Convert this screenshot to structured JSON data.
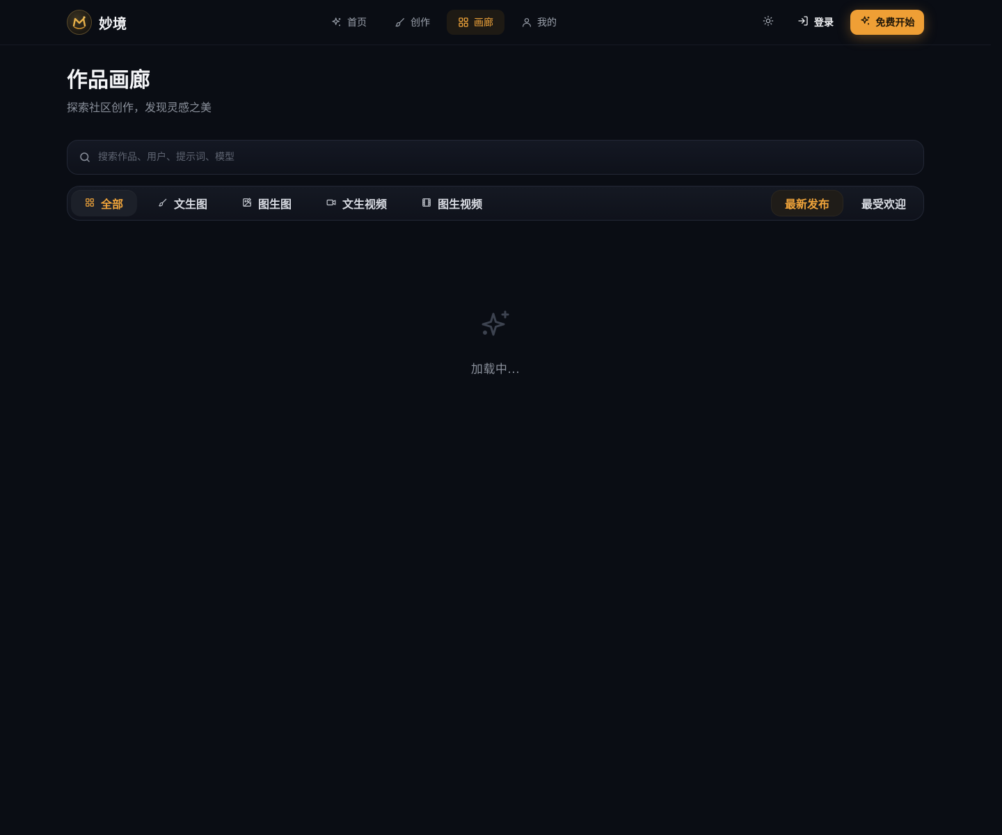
{
  "brand": {
    "name": "妙境",
    "logo_icon": "brand-logo-icon",
    "accent_color": "#ef9f35"
  },
  "nav": {
    "items": [
      {
        "label": "首页",
        "icon": "sparkles-icon",
        "active": false
      },
      {
        "label": "创作",
        "icon": "brush-icon",
        "active": false
      },
      {
        "label": "画廊",
        "icon": "grid-icon",
        "active": true
      },
      {
        "label": "我的",
        "icon": "user-icon",
        "active": false
      }
    ]
  },
  "header_actions": {
    "theme_icon": "sun-icon",
    "login_label": "登录",
    "login_icon": "login-icon",
    "start_label": "免费开始",
    "start_icon": "sparkles-icon"
  },
  "page": {
    "title": "作品画廊",
    "subtitle": "探索社区创作，发现灵感之美"
  },
  "search": {
    "placeholder": "搜索作品、用户、提示词、模型",
    "value": ""
  },
  "filters": {
    "categories": [
      {
        "label": "全部",
        "icon": "grid-icon",
        "active": true
      },
      {
        "label": "文生图",
        "icon": "brush-icon",
        "active": false
      },
      {
        "label": "图生图",
        "icon": "image-edit-icon",
        "active": false
      },
      {
        "label": "文生视频",
        "icon": "video-camera-icon",
        "active": false
      },
      {
        "label": "图生视频",
        "icon": "film-icon",
        "active": false
      }
    ],
    "sort": [
      {
        "label": "最新发布",
        "active": true
      },
      {
        "label": "最受欢迎",
        "active": false
      }
    ]
  },
  "loading": {
    "icon": "sparkles-icon",
    "text": "加载中..."
  }
}
